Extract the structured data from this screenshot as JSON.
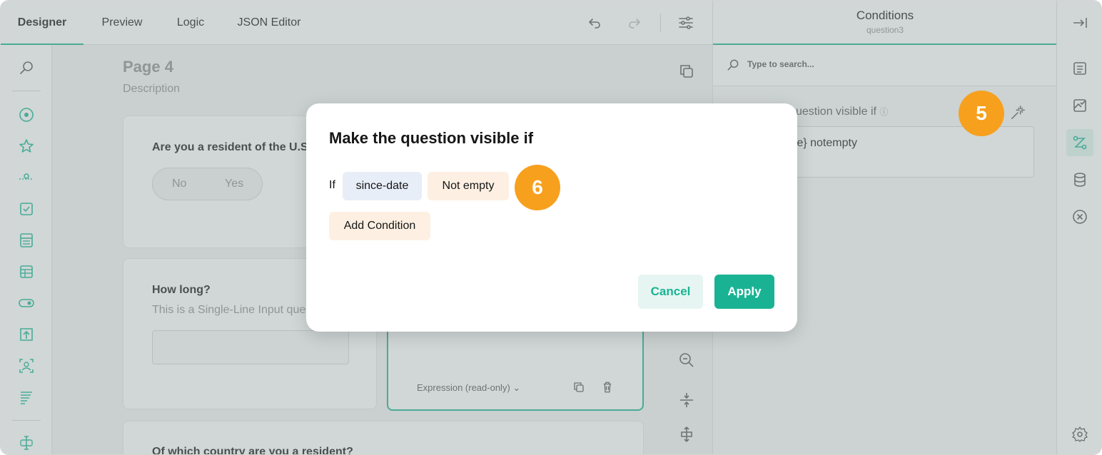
{
  "topbar": {
    "tabs": [
      {
        "label": "Designer",
        "active": true
      },
      {
        "label": "Preview",
        "active": false
      },
      {
        "label": "Logic",
        "active": false
      },
      {
        "label": "JSON Editor",
        "active": false
      }
    ],
    "icons": [
      "undo-icon",
      "redo-icon",
      "settings-sliders-icon"
    ]
  },
  "toolbox": {
    "icons": [
      "search-icon",
      "radio-icon",
      "rating-star-icon",
      "slider-icon",
      "checkbox-icon",
      "dropdown-icon",
      "matrix-icon",
      "toggle-icon",
      "file-upload-icon",
      "image-icon",
      "ranking-icon",
      "text-cursor-icon"
    ]
  },
  "canvas": {
    "page_title": "Page 4",
    "page_description": "Description",
    "questions": [
      {
        "title": "Are you a resident of the U.S.",
        "options": [
          "No",
          "Yes"
        ]
      },
      {
        "title": "How long?",
        "description": "This is a Single-Line Input que"
      },
      {
        "type_label": "Expression (read-only)"
      },
      {
        "title": "Of which country are you a resident?"
      }
    ]
  },
  "properties": {
    "title": "Conditions",
    "subtitle": "question3",
    "search_placeholder": "Type to search...",
    "visible_if_label": "uestion visible if",
    "visible_if_value": "te} notempty"
  },
  "right_tabs": [
    "general-list-icon",
    "image-check-icon",
    "logic-connector-icon",
    "database-icon",
    "close-circle-icon",
    "gear-icon"
  ],
  "badges": {
    "step5": "5",
    "step6": "6"
  },
  "modal": {
    "title": "Make the question visible if",
    "if_label": "If",
    "question_chip": "since-date",
    "operator_chip": "Not empty",
    "add_condition": "Add Condition",
    "cancel": "Cancel",
    "apply": "Apply"
  },
  "colors": {
    "accent": "#19b394",
    "badge": "#f7a01e",
    "question_chip": "#e8eef8",
    "operator_chip": "#fdf0e2"
  }
}
